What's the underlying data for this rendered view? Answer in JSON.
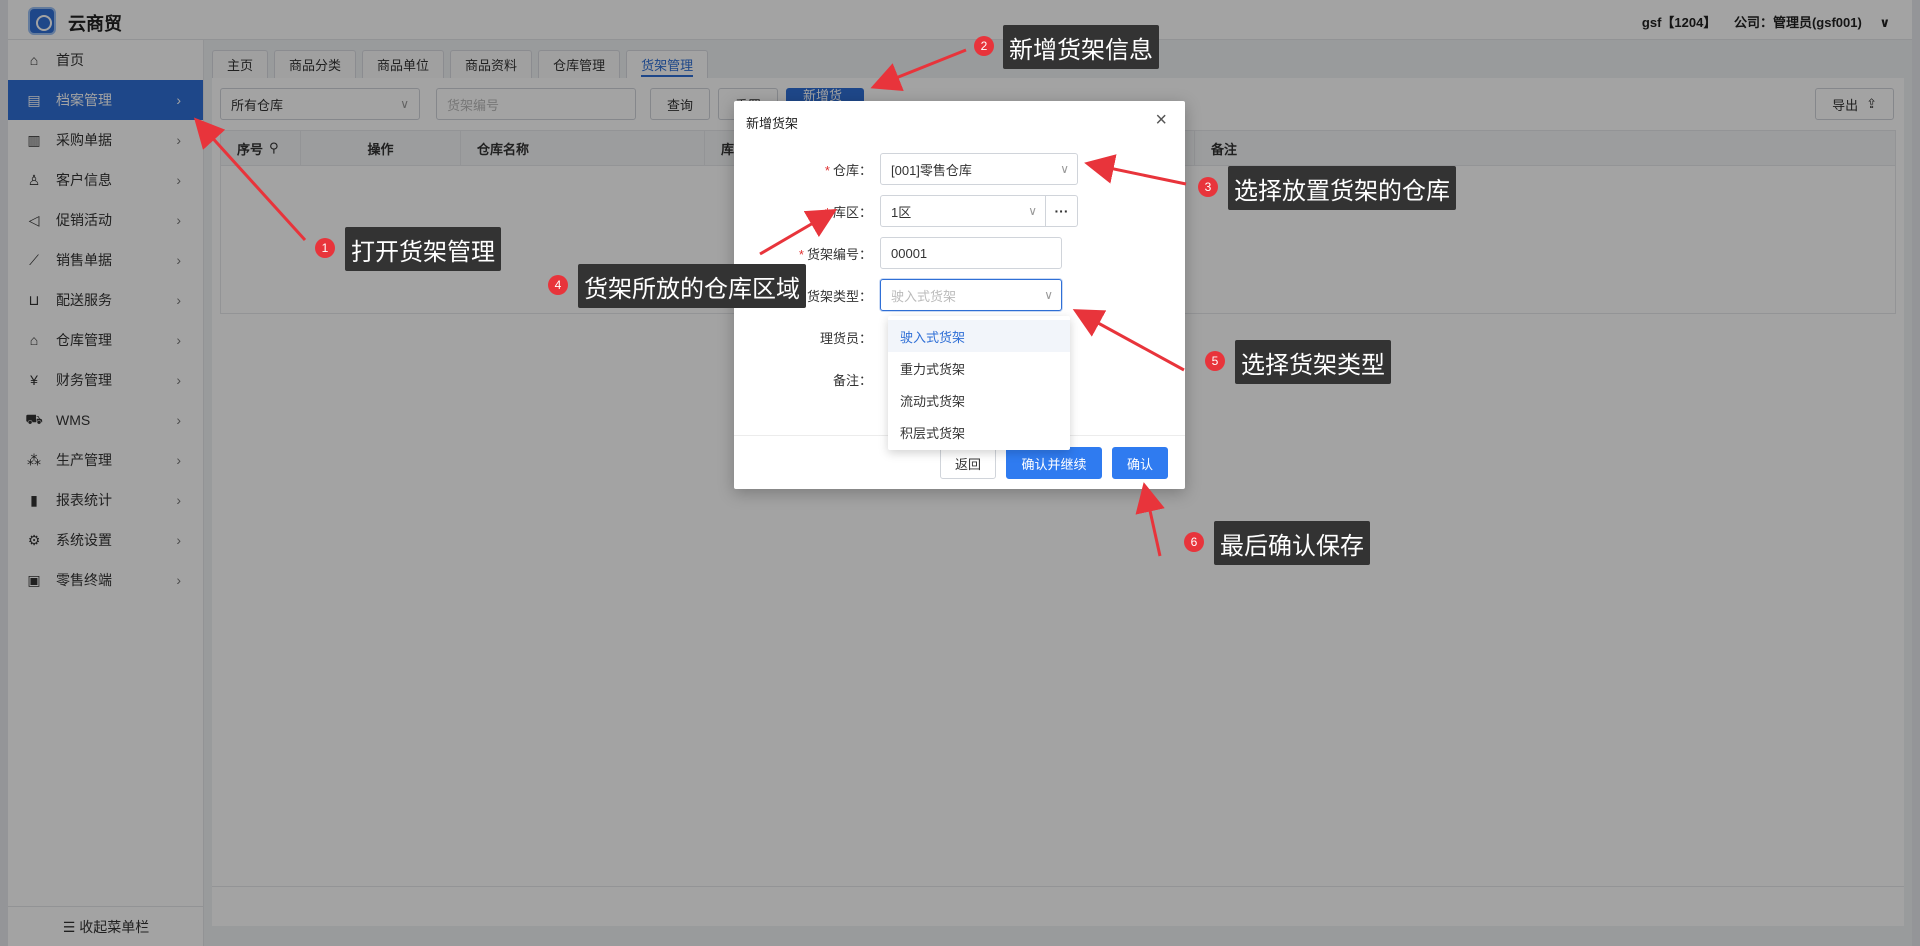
{
  "app": {
    "title": "云商贸"
  },
  "user": {
    "account": "gsf【1204】",
    "company": "公司：管理员(gsf001)",
    "chevron": "chevron-down-icon"
  },
  "sidebar": {
    "items": [
      {
        "label": "首页",
        "icon": "home-icon"
      },
      {
        "label": "档案管理",
        "icon": "archive-icon",
        "active": true
      },
      {
        "label": "采购单据",
        "icon": "receipt-icon"
      },
      {
        "label": "客户信息",
        "icon": "user-icon"
      },
      {
        "label": "促销活动",
        "icon": "megaphone-icon"
      },
      {
        "label": "销售单据",
        "icon": "chart-line-icon"
      },
      {
        "label": "配送服务",
        "icon": "cart-icon"
      },
      {
        "label": "仓库管理",
        "icon": "warehouse-icon"
      },
      {
        "label": "财务管理",
        "icon": "yen-icon"
      },
      {
        "label": "WMS",
        "icon": "truck-icon"
      },
      {
        "label": "生产管理",
        "icon": "network-icon"
      },
      {
        "label": "报表统计",
        "icon": "bar-chart-icon"
      },
      {
        "label": "系统设置",
        "icon": "gear-icon"
      },
      {
        "label": "零售终端",
        "icon": "bag-icon"
      }
    ],
    "collapse_label": "☰ 收起菜单栏"
  },
  "tabs": [
    {
      "label": "主页"
    },
    {
      "label": "商品分类"
    },
    {
      "label": "商品单位"
    },
    {
      "label": "商品资料"
    },
    {
      "label": "仓库管理"
    },
    {
      "label": "货架管理",
      "active": true
    }
  ],
  "filters": {
    "warehouse_value": "所有仓库",
    "shelf_placeholder": "货架编号",
    "query_label": "查询",
    "reset_label": "重置",
    "add_label": "新增货架",
    "export_label": "导出"
  },
  "table": {
    "columns": [
      "序号",
      "操作",
      "仓库名称",
      "库区",
      "备注"
    ]
  },
  "dialog": {
    "title": "新增货架",
    "fields": {
      "warehouse_label": "仓库：",
      "warehouse_value": "[001]零售仓库",
      "zone_label": "库区：",
      "zone_value": "1区",
      "zone_more": "···",
      "code_label": "货架编号：",
      "code_value": "00001",
      "type_label": "货架类型：",
      "type_placeholder": "驶入式货架",
      "clerk_label": "理货员：",
      "remark_label": "备注："
    },
    "buttons": {
      "back": "返回",
      "confirm_continue": "确认并继续",
      "confirm": "确认"
    }
  },
  "dropdown": {
    "options": [
      "驶入式货架",
      "重力式货架",
      "流动式货架",
      "积层式货架"
    ],
    "selected": "驶入式货架"
  },
  "annotations": [
    {
      "num": "1",
      "text": "打开货架管理"
    },
    {
      "num": "2",
      "text": "新增货架信息"
    },
    {
      "num": "3",
      "text": "选择放置货架的仓库"
    },
    {
      "num": "4",
      "text": "货架所放的仓库区域"
    },
    {
      "num": "5",
      "text": "选择货架类型"
    },
    {
      "num": "6",
      "text": "最后确认保存"
    }
  ],
  "colors": {
    "primary": "#2f6fd6",
    "annotation_red": "#e8343b",
    "callout_bg": "#333333"
  }
}
